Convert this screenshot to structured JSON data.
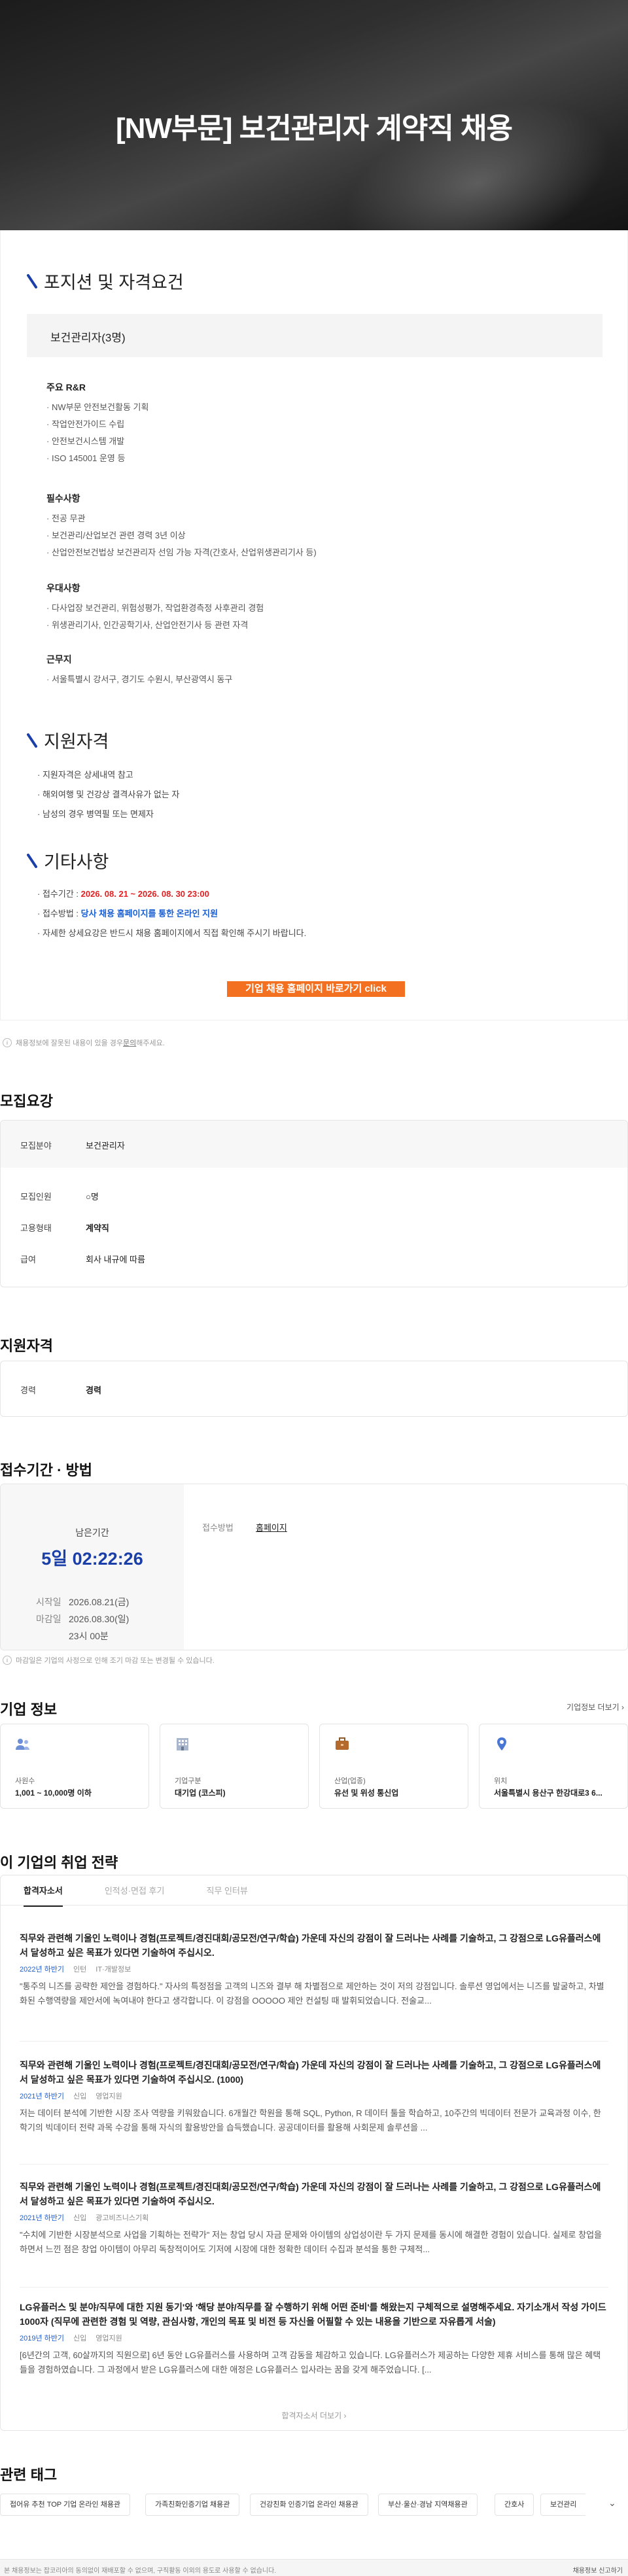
{
  "hero": {
    "title": "[NW부문] 보건관리자 계약직 채용"
  },
  "posting": {
    "section1": "포지션 및 자격요건",
    "role": "보건관리자(3명)",
    "groups": [
      {
        "title": "주요 R&R",
        "items": [
          "NW부문 안전보건활동 기획",
          "작업안전가이드 수립",
          "안전보건시스템 개발",
          "ISO 145001 운영 등"
        ]
      },
      {
        "title": "필수사항",
        "items": [
          "전공 무관",
          "보건관리/산업보건 관련 경력 3년 이상",
          "산업안전보건법상 보건관리자 선임 가능 자격(간호사, 산업위생관리기사 등)"
        ]
      },
      {
        "title": "우대사항",
        "items": [
          "다사업장 보건관리, 위험성평가, 작업환경측정 사후관리 경험",
          "위생관리기사, 인간공학기사, 산업안전기사 등 관련 자격"
        ]
      },
      {
        "title": "근무지",
        "items": [
          "서울특별시 강서구, 경기도 수원시, 부산광역시 동구"
        ]
      }
    ],
    "section2": "지원자격",
    "qual_items": [
      "지원자격은 상세내역 참고",
      "해외여행 및 건강상 결격사유가 없는 자",
      "남성의 경우 병역필 또는 면제자"
    ],
    "section3": "기타사항",
    "etc": {
      "period_label": "접수기간 : ",
      "period_value": "2026. 08. 21 ~ 2026. 08. 30 23:00",
      "method_label": "접수방법 : ",
      "method_value": "당사 채용 홈페이지를 통한 온라인 지원",
      "note": "자세한 상세요강은 반드시 채용 홈페이지에서 직접 확인해 주시기 바랍니다."
    },
    "cta": "기업 채용 홈페이지 바로가기 click"
  },
  "notice1": {
    "pre": "채용정보에 잘못된 내용이 있을 경우 ",
    "link": "문의",
    "post": "해주세요."
  },
  "recruit": {
    "heading": "모집요강",
    "field_label": "모집분야",
    "field_value": "보건관리자",
    "count_label": "모집인원",
    "count_value": "○명",
    "type_label": "고용형태",
    "type_value": "계약직",
    "pay_label": "급여",
    "pay_value": "회사 내규에 따름"
  },
  "qualification": {
    "heading": "지원자격",
    "career_label": "경력",
    "career_value": "경력"
  },
  "deadline": {
    "heading": "접수기간 · 방법",
    "remain_label": "남은기간",
    "remain_value": "5일 02:22:26",
    "start_label": "시작일",
    "start_value": "2026.08.21(금)",
    "end_label": "마감일",
    "end_value": "2026.08.30(일)",
    "end_time": "23시 00분",
    "method_label": "접수방법",
    "method_value": "홈페이지",
    "notice": "마감일은 기업의 사정으로 인해 조기 마감 또는 변경될 수 있습니다."
  },
  "company": {
    "heading": "기업 정보",
    "more": "기업정보 더보기",
    "cards": [
      {
        "icon": "people-icon",
        "label": "사원수",
        "value": "1,001 ~ 10,000명 이하"
      },
      {
        "icon": "building-icon",
        "label": "기업구분",
        "value": "대기업 (코스피)"
      },
      {
        "icon": "briefcase-icon",
        "label": "산업(업종)",
        "value": "유선 및 위성 통신업"
      },
      {
        "icon": "location-pin-icon",
        "label": "위치",
        "value": "서울특별시 용산구 한강대로3 6..."
      }
    ]
  },
  "strategy": {
    "heading": "이 기업의 취업 전략",
    "tabs": [
      "합격자소서",
      "인적성·면접 후기",
      "직무 인터뷰"
    ],
    "stories": [
      {
        "q": "직무와 관련해 기울인 노력이나 경험(프로젝트/경진대회/공모전/연구/학습) 가운데 자신의 강점이 잘 드러나는 사례를 기술하고, 그 강점으로 LG유플러스에서 달성하고 싶은 목표가 있다면 기술하여 주십시오.",
        "year": "2022년 하반기",
        "level": "인턴",
        "job": "IT·개발정보",
        "a": "\"통주의 니즈를 공략한 제안을 경험하다.\" 자사의 특정점을 고객의 니즈와 결부 해 차별점으로 제안하는 것이 저의 강점입니다. 솔루션 영업에서는 니즈를 발굴하고, 차별화된 수행역량을 제안서에 녹여내야 한다고 생각합니다. 이 강점을 OOOOO 제안 컨설팅 때 발휘되었습니다. 전술교..."
      },
      {
        "q": "직무와 관련해 기울인 노력이나 경험(프로젝트/경진대회/공모전/연구/학습) 가운데 자신의 강점이 잘 드러나는 사례를 기술하고, 그 강점으로 LG유플러스에서 달성하고 싶은 목표가 있다면 기술하여 주십시오. (1000)",
        "year": "2021년 하반기",
        "level": "신입",
        "job": "영업지원",
        "a": "저는 데이터 분석에 기반한 시장 조사 역량을 키워왔습니다. 6개월간 학원을 통해 SQL, Python, R 데이터 툴을 학습하고, 10주간의 빅데이터 전문가 교육과정 이수, 한 학기의 빅데이터 전략 과목 수강을 통해 자식의 활용방안을 습득했습니다. 공공데이터를 활용해 사회문제 솔루션을 ..."
      },
      {
        "q": "직무와 관련해 기울인 노력이나 경험(프로젝트/경진대회/공모전/연구/학습) 가운데 자신의 강점이 잘 드러나는 사례를 기술하고, 그 강점으로 LG유플러스에서 달성하고 싶은 목표가 있다면 기술하여 주십시오.",
        "year": "2021년 하반기",
        "level": "신입",
        "job": "광고비즈니스기획",
        "a": "\"수치에 기반한 시장분석으로 사업을 기획하는 전략가\" 저는 창업 당시 자금 문제와 아이템의 상업성이란 두 가지 문제를 동시에 해결한 경험이 있습니다. 실제로 창업을 하면서 느낀 점은 창업 아이템이 아무리 독창적이어도 기저에 시장에 대한 정확한 데이터 수집과 분석을 통한 구체적..."
      },
      {
        "q": "LG유플러스 및 분야/직무에 대한 지원 동기'와 '해당 분야/직무를 잘 수행하기 위해 어떤 준비'를 해왔는지 구체적으로 설명해주세요. 자기소개서 작성 가이드 1000자 (직무에 관련한 경험 및 역량, 관심사항, 개인의 목표 및 비전 등 자신을 어필할 수 있는 내용을 기반으로 자유롭게 서술)",
        "year": "2019년 하반기",
        "level": "신입",
        "job": "영업지원",
        "a": "[6년간의 고객, 60살까지의 직원으로] 6년 동안 LG유플러스를 사용하며 고객 감동을 체감하고 있습니다. LG유플러스가 제공하는 다양한 제휴 서비스를 통해 많은 혜택들을 경험하였습니다. 그 과정에서 받은 LG유플러스에 대한 애정은 LG유플러스 입사라는 꿈을 갖게 해주었습니다. [..."
      }
    ],
    "more": "합격자소서 더보기"
  },
  "tags": {
    "heading": "관련 태그",
    "items": [
      "접어유 추천 TOP 기업 온라인 채용관",
      "가족친화인증기업 채용관",
      "건강친화 인증기업 온라인 채용관",
      "부산·울산·경남 지역채용관",
      "간호사",
      "보건관리"
    ]
  },
  "footer": {
    "left": "본 채용정보는 잡코리아의 동의없이 재배포할 수 없으며, 구직활동 이외의 용도로 사용할 수 없습니다.",
    "right": "채용정보 신고하기"
  }
}
